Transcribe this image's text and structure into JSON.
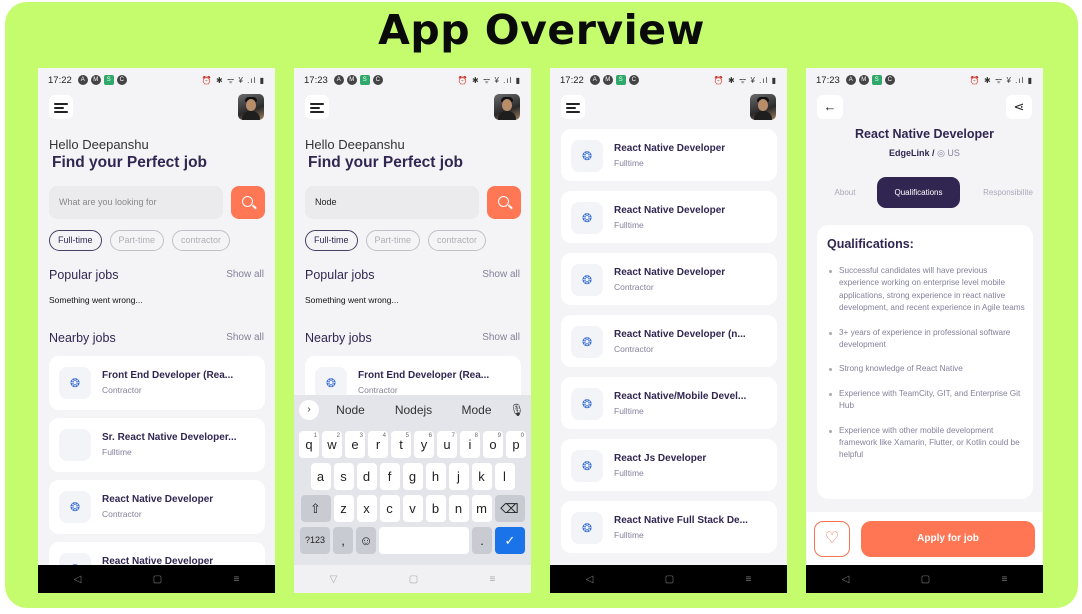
{
  "title": "App Overview",
  "status": {
    "time1": "17:22",
    "time2": "17:23",
    "time3": "17:22",
    "time4": "17:23",
    "icons_left": [
      "A",
      "M",
      "S",
      "C"
    ],
    "icons_right": "⏰ ✱ ᯤ ¥ .ıl ▮"
  },
  "home": {
    "greeting": "Hello Deepanshu",
    "headline": "Find your Perfect job",
    "search_placeholder": "What are you looking for",
    "search_typed": "Node",
    "chips": [
      "Full-time",
      "Part-time",
      "contractor"
    ],
    "popular_title": "Popular jobs",
    "show_all": "Show all",
    "error": "Something went wrong...",
    "nearby_title": "Nearby jobs",
    "jobs": [
      {
        "title": "Front End Developer (Rea...",
        "type": "Contractor"
      },
      {
        "title": "Sr. React Native Developer...",
        "type": "Fulltime"
      },
      {
        "title": "React Native Developer",
        "type": "Contractor"
      },
      {
        "title": "React Native Developer",
        "type": ""
      }
    ]
  },
  "keyboard": {
    "suggestions": [
      "Node",
      "Nodejs",
      "Mode"
    ],
    "row1": [
      "q",
      "w",
      "e",
      "r",
      "t",
      "y",
      "u",
      "i",
      "o",
      "p"
    ],
    "row1_sup": [
      "1",
      "2",
      "3",
      "4",
      "5",
      "6",
      "7",
      "8",
      "9",
      "0"
    ],
    "row2": [
      "a",
      "s",
      "d",
      "f",
      "g",
      "h",
      "j",
      "k",
      "l"
    ],
    "row3": [
      "z",
      "x",
      "c",
      "v",
      "b",
      "n",
      "m"
    ],
    "num_label": "?123",
    "comma": ",",
    "period": ".",
    "shift": "⇧",
    "backspace": "⌫",
    "emoji": "☺",
    "enter": "✓",
    "arrow": "›",
    "mic": "🎙"
  },
  "search_results": [
    {
      "title": "React Native Developer",
      "type": "Fulltime"
    },
    {
      "title": "React Native Developer",
      "type": "Fulltime"
    },
    {
      "title": "React Native Developer",
      "type": "Contractor"
    },
    {
      "title": "React Native Developer (n...",
      "type": "Contractor"
    },
    {
      "title": "React Native/Mobile Devel...",
      "type": "Fulltime"
    },
    {
      "title": "React Js Developer",
      "type": "Fulltime"
    },
    {
      "title": "React Native Full Stack De...",
      "type": "Fulltime"
    }
  ],
  "details": {
    "job_title": "React Native Developer",
    "company": "EdgeLink /",
    "location": "◎ US",
    "tabs": [
      "About",
      "Qualifications",
      "Responsibilite"
    ],
    "qual_heading": "Qualifications:",
    "qualifications": [
      "Successful candidates will have previous experience working on enterprise level mobile applications, strong experience in react native development, and recent experience in Agile teams",
      "3+ years of experience in professional software development",
      "Strong knowledge of React Native",
      "Experience with TeamCity, GIT, and Enterprise Git Hub",
      "Experience with other mobile development framework like Xamarin, Flutter, or Kotlin could be helpful"
    ],
    "like_icon": "♡",
    "apply": "Apply for job",
    "back_icon": "←",
    "share_icon": "⋖"
  },
  "nav": [
    "◁",
    "▢",
    "≡"
  ],
  "nav_light": [
    "▽",
    "▢",
    "≡"
  ],
  "colors": {
    "accent": "#ff7754",
    "primary": "#312651",
    "background": "#c4fc6e"
  }
}
